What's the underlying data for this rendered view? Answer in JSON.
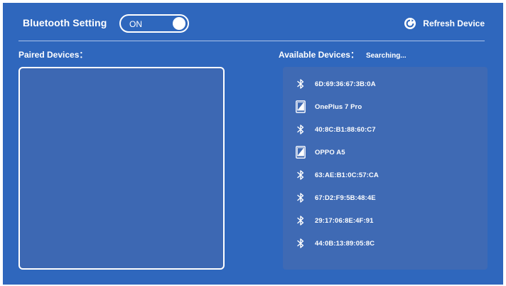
{
  "header": {
    "title": "Bluetooth Setting",
    "toggle_label": "ON",
    "refresh_label": "Refresh Device"
  },
  "paired": {
    "label": "Paired Devices："
  },
  "available": {
    "label": "Available Devices：",
    "status": "Searching...",
    "devices": [
      {
        "name": "6D:69:36:67:3B:0A",
        "icon": "bluetooth-icon"
      },
      {
        "name": "OnePlus 7 Pro",
        "icon": "phone-icon"
      },
      {
        "name": "40:8C:B1:88:60:C7",
        "icon": "bluetooth-icon"
      },
      {
        "name": "OPPO A5",
        "icon": "phone-icon"
      },
      {
        "name": "63:AE:B1:0C:57:CA",
        "icon": "bluetooth-icon"
      },
      {
        "name": "67:D2:F9:5B:48:4E",
        "icon": "bluetooth-icon"
      },
      {
        "name": "29:17:06:8E:4F:91",
        "icon": "bluetooth-icon"
      },
      {
        "name": "44:0B:13:89:05:8C",
        "icon": "bluetooth-icon"
      }
    ]
  },
  "colors": {
    "background": "#2f67bd",
    "panel": "#3f6ab4",
    "text": "#ffffff"
  }
}
